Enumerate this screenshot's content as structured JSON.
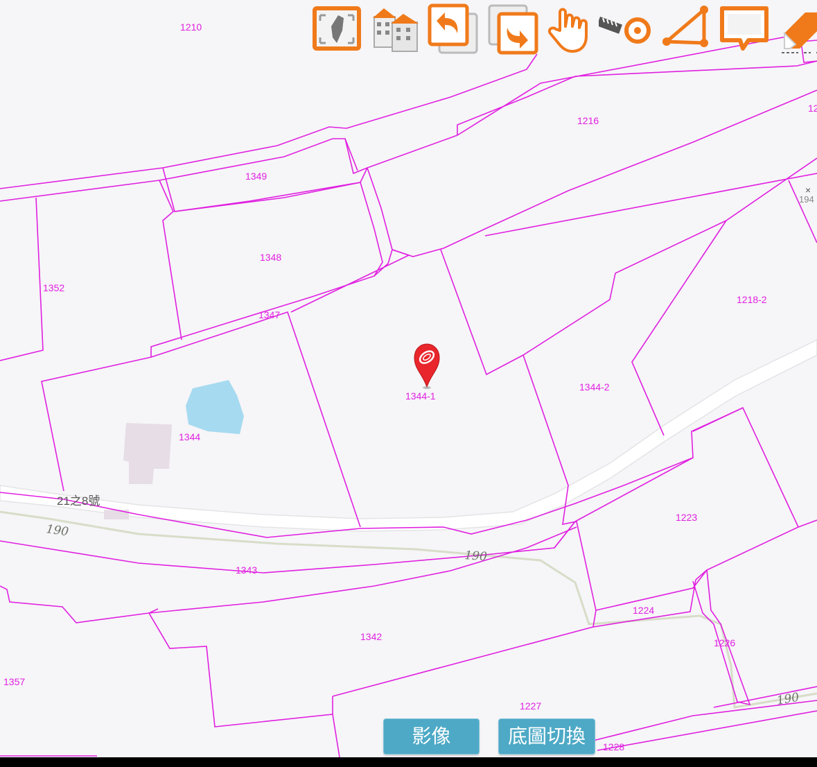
{
  "map": {
    "parcels": [
      "1210",
      "1216",
      "12",
      "1349",
      "1348",
      "1347",
      "1352",
      "1218-2",
      "1344-1",
      "1344-2",
      "1344",
      "1223",
      "1343",
      "1224",
      "1342",
      "1226",
      "1357",
      "1227",
      "1228"
    ],
    "partial_label": "194",
    "address": "21之8號",
    "road_number": "190",
    "marker_label": "1344-1"
  },
  "colors": {
    "parcel_line": "#e020e0",
    "background": "#f6f5f8",
    "road": "#ffffff",
    "pond": "#a6daf0",
    "building": "#e6dde6",
    "button": "#4da9c6",
    "tool_orange": "#f07a1a",
    "marker": "#e8262b"
  },
  "toolbar": {
    "tools": [
      "fullscreen-taiwan-icon",
      "buildings-icon",
      "undo-icon",
      "redo-icon",
      "pan-hand-icon",
      "measure-distance-icon",
      "measure-area-icon",
      "comment-icon",
      "eraser-icon"
    ]
  },
  "buttons": {
    "imagery": "影像",
    "basemap_switch": "底圖切換"
  }
}
